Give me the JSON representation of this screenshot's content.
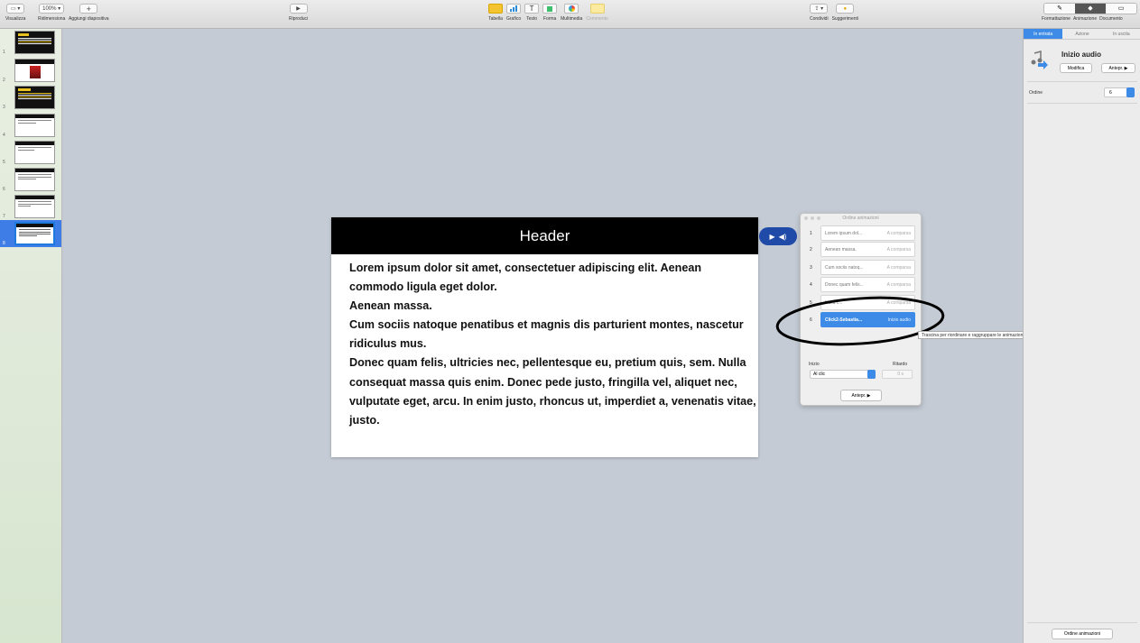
{
  "toolbar": {
    "view_label": "Visualizza",
    "zoom_value": "100%",
    "zoom_label": "Ridimensiona",
    "add_slide_label": "Aggiungi diapositiva",
    "play_label": "Riproduci",
    "table_label": "Tabella",
    "chart_label": "Grafico",
    "text_label": "Testo",
    "shape_label": "Forma",
    "media_label": "Multimedia",
    "comment_label": "Commento",
    "share_label": "Condividi",
    "tips_label": "Suggerimenti",
    "format_label": "Formattazione",
    "animate_label": "Animazione",
    "document_label": "Documento"
  },
  "sidebar": {
    "slides": [
      {
        "number": "1",
        "style": "dark-yellow"
      },
      {
        "number": "2",
        "style": "photo"
      },
      {
        "number": "3",
        "style": "dark-yellow"
      },
      {
        "number": "4",
        "style": "white"
      },
      {
        "number": "5",
        "style": "white"
      },
      {
        "number": "6",
        "style": "white"
      },
      {
        "number": "7",
        "style": "white"
      },
      {
        "number": "8",
        "style": "white",
        "selected": true
      }
    ]
  },
  "slide": {
    "header": "Header",
    "paragraphs": [
      "Lorem ipsum dolor sit amet, consectetuer adipiscing elit. Aenean commodo ligula eget dolor.",
      "Aenean massa.",
      "Cum sociis natoque penatibus et magnis dis parturient montes, nascetur ridiculus mus.",
      "Donec quam felis, ultricies nec, pellentesque eu, pretium quis, sem. Nulla consequat massa quis enim. Donec pede justo, fringilla vel, aliquet nec, vulputate eget, arcu. In enim justo, rhoncus ut, imperdiet a, venenatis vitae, justo."
    ]
  },
  "anim_panel": {
    "title": "Ordine animazioni",
    "items": [
      {
        "num": "1",
        "name": "Lorem ipsum dol...",
        "effect": "A comparsa"
      },
      {
        "num": "2",
        "name": "Aenean massa.",
        "effect": "A comparsa"
      },
      {
        "num": "3",
        "name": "Cum sociis natoq...",
        "effect": "A comparsa"
      },
      {
        "num": "4",
        "name": "Donec quam felis...",
        "effect": "A comparsa"
      },
      {
        "num": "5",
        "name": "Nulla c...",
        "effect": "A comparsa"
      },
      {
        "num": "6",
        "name": "Click2-Sebastia...",
        "effect": "Inizio audio",
        "selected": true
      }
    ],
    "start_label": "Inizio",
    "start_value": "Al clic",
    "delay_label": "Ritardo",
    "delay_value": "0 s",
    "preview_label": "Antepr. ▶"
  },
  "tooltip": "Trascina per riordinare e raggruppare le animazioni.",
  "inspector": {
    "tabs": [
      "In entrata",
      "Azione",
      "In uscita"
    ],
    "title": "Inizio audio",
    "edit_label": "Modifica",
    "preview_label": "Antepr. ▶",
    "order_label": "Ordine",
    "order_value": "6",
    "anim_order_button": "Ordine animazioni"
  },
  "colors": {
    "accent": "#3d8be6",
    "canvas": "#c4cbd4",
    "highlight_ellipse": "#000000"
  }
}
